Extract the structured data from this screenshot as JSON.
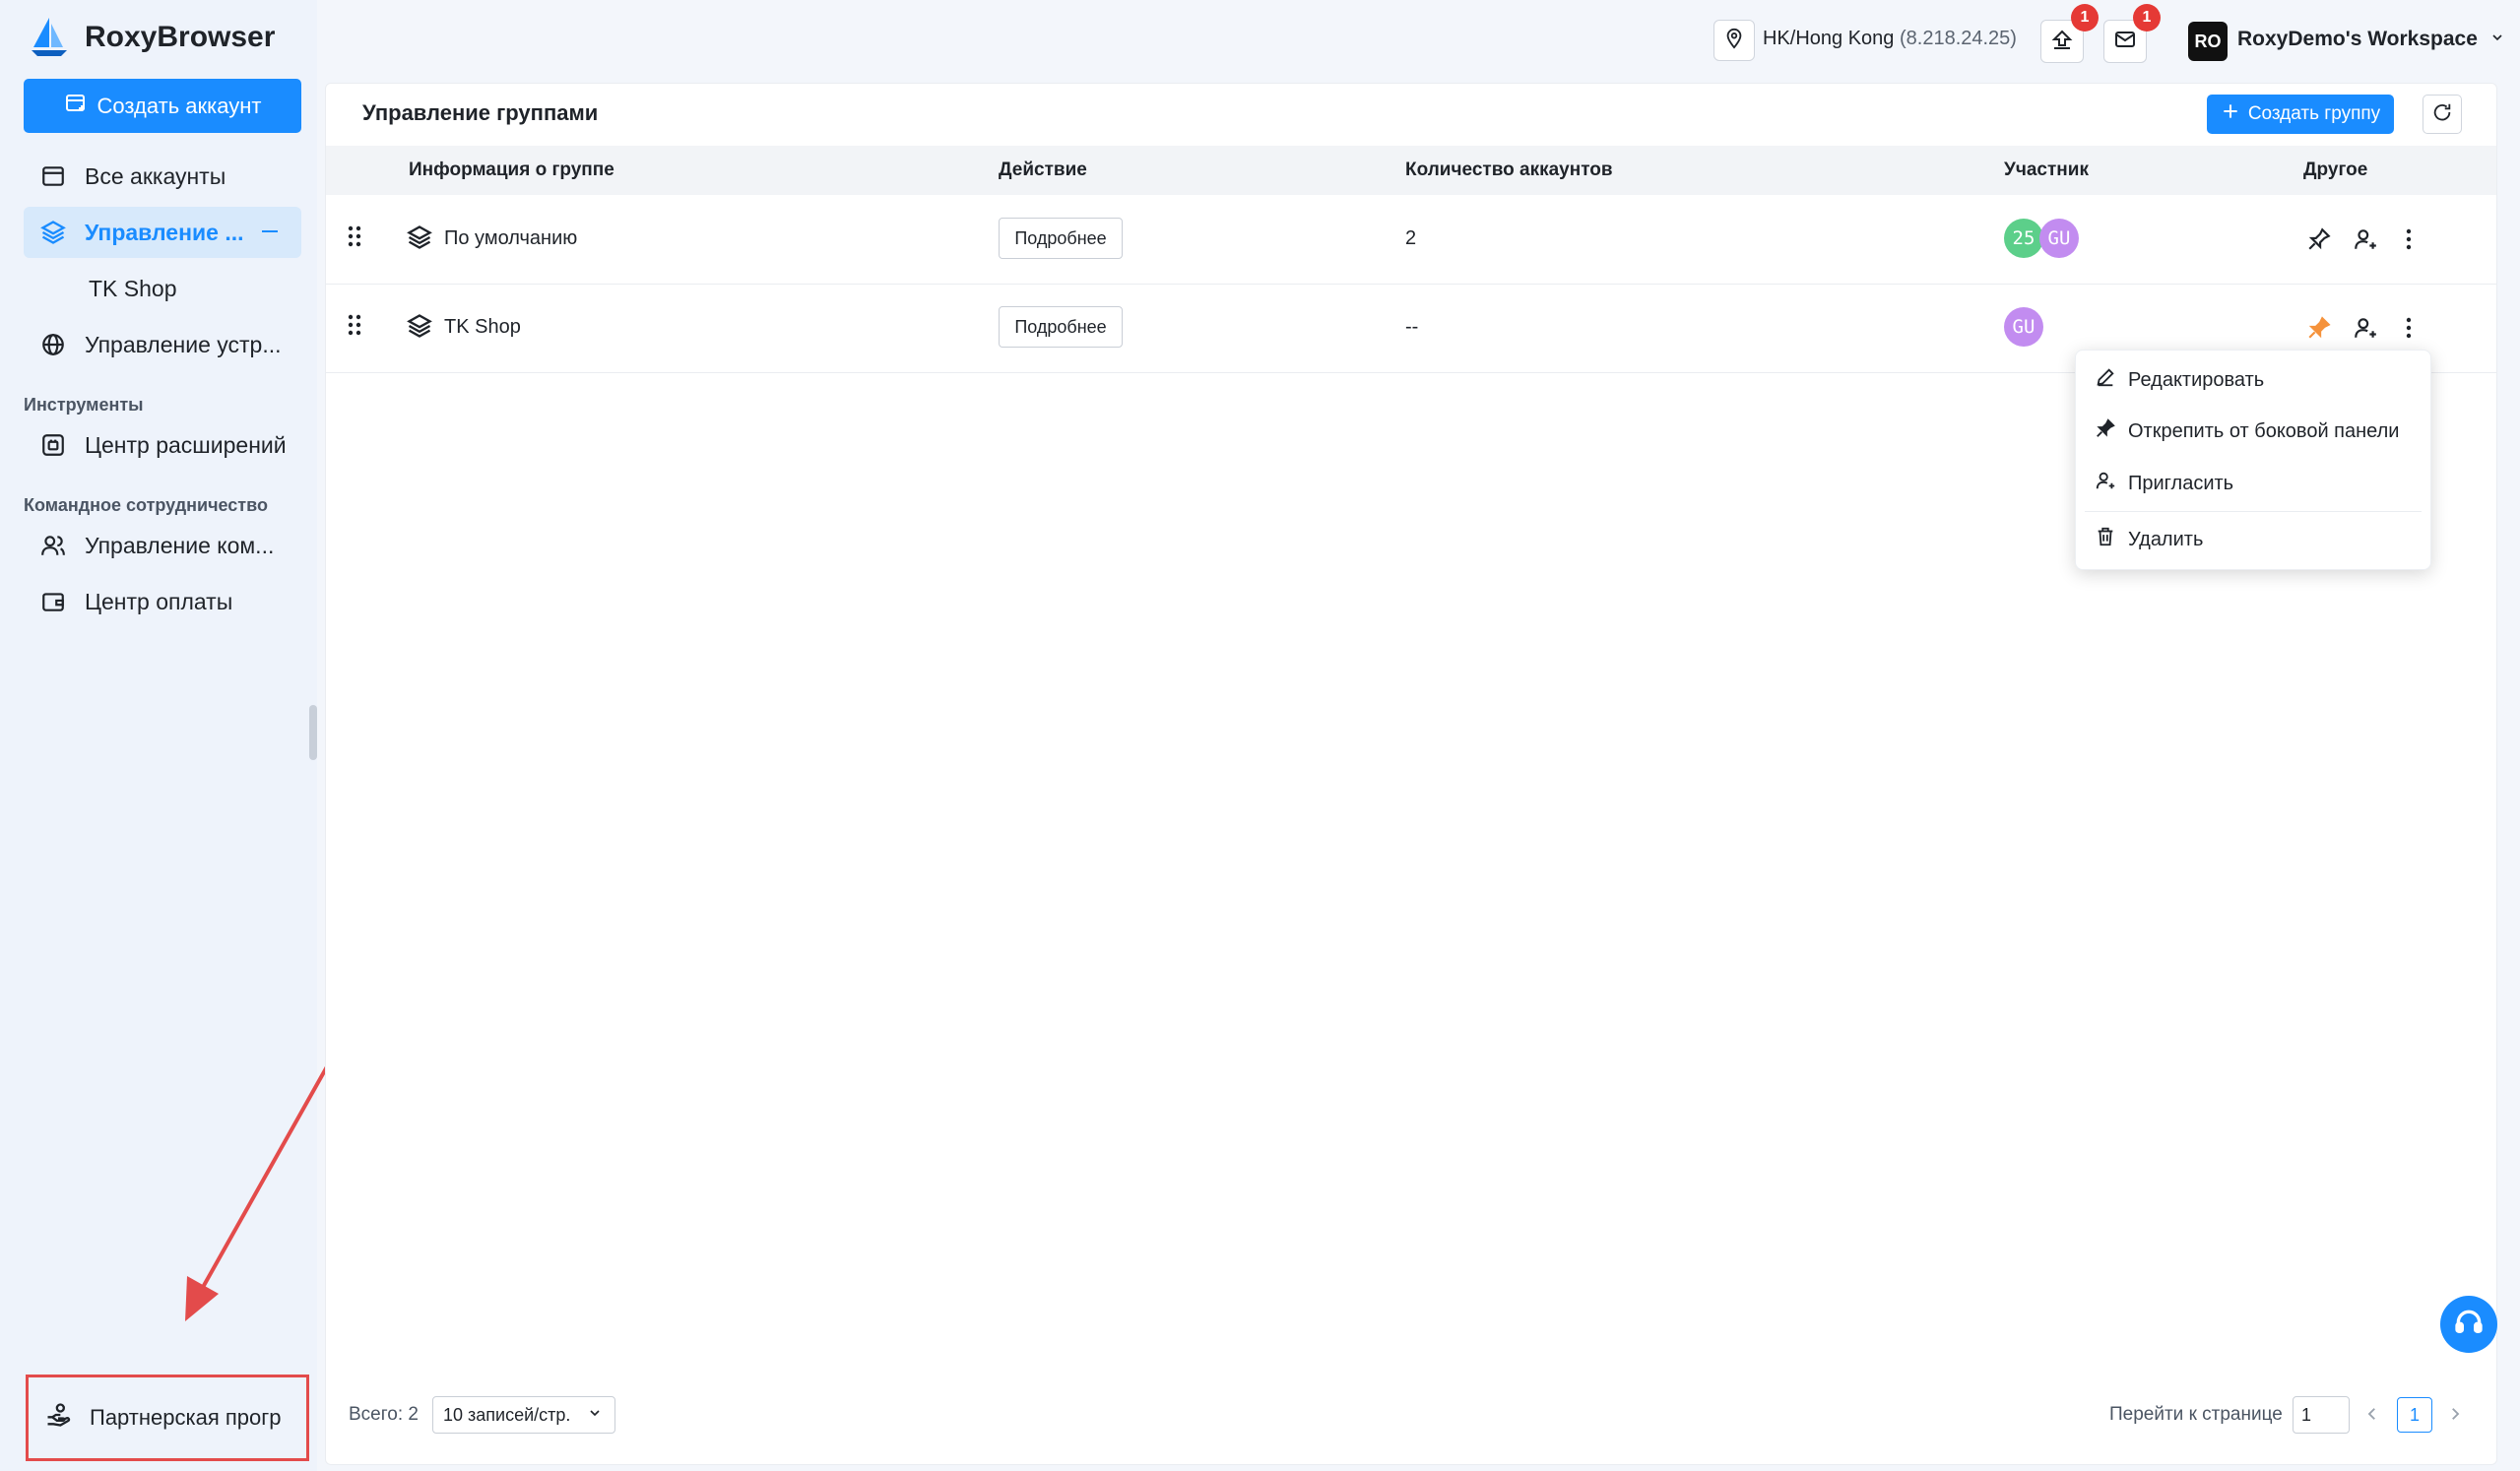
{
  "app": {
    "name": "RoxyBrowser",
    "create_account": "Создать аккаунт"
  },
  "sidebar": {
    "items": [
      {
        "label": "Все аккаунты"
      },
      {
        "label": "Управление ..."
      },
      {
        "label": "TK Shop"
      },
      {
        "label": "Управление устр..."
      }
    ],
    "tools_label": "Инструменты",
    "tools_items": [
      {
        "label": "Центр расширений"
      }
    ],
    "team_label": "Командное сотрудничество",
    "team_items": [
      {
        "label": "Управление ком..."
      },
      {
        "label": "Центр оплаты"
      }
    ],
    "partner": "Партнерская прогр"
  },
  "topbar": {
    "location": "HK/Hong Kong",
    "ip": "(8.218.24.25)",
    "upload_badge": "1",
    "mail_badge": "1",
    "workspace_initials": "RO",
    "workspace_name": "RoxyDemo's Workspace"
  },
  "main": {
    "title": "Управление группами",
    "create_group": "Создать группу",
    "columns": [
      "Информация о группе",
      "Действие",
      "Количество аккаунтов",
      "Участник",
      "Другое"
    ],
    "rows": [
      {
        "name": "По умолчанию",
        "action": "Подробнее",
        "count": "2",
        "members": [
          "25",
          "GU"
        ]
      },
      {
        "name": "TK Shop",
        "action": "Подробнее",
        "count": "--",
        "members": [
          "GU"
        ]
      }
    ]
  },
  "menu": {
    "items": [
      "Редактировать",
      "Открепить от боковой панели",
      "Пригласить",
      "Удалить"
    ]
  },
  "footer": {
    "total": "Всего: 2",
    "page_size": "10 записей/стр.",
    "goto_label": "Перейти к странице",
    "goto_value": "1",
    "current_page": "1"
  },
  "colors": {
    "accent": "#1a8cff",
    "avatar_green": "#5ccf8a",
    "avatar_purple": "#c28cf0",
    "pin_active": "#f5923b",
    "annotation_red": "#e34b4b"
  }
}
